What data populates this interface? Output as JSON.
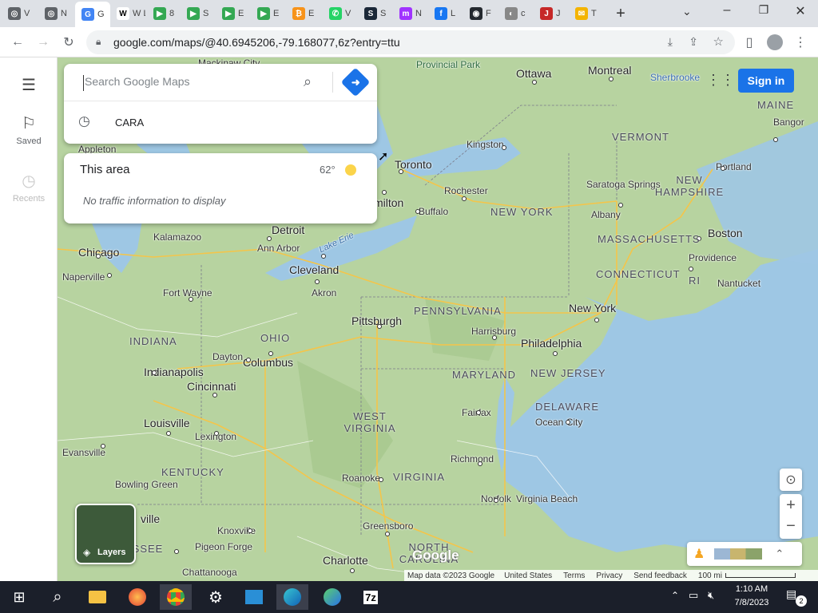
{
  "browser": {
    "tabs": [
      {
        "label": "V",
        "fav_color": "#5f6368",
        "fav_text": "◎"
      },
      {
        "label": "N",
        "fav_color": "#5f6368",
        "fav_text": "◎"
      },
      {
        "label": "G",
        "fav_color": "#4285f4",
        "fav_text": "G",
        "active": true
      },
      {
        "label": "W L",
        "fav_color": "#fff",
        "fav_text": "W"
      },
      {
        "label": "8",
        "fav_color": "#34a853",
        "fav_text": "▶"
      },
      {
        "label": "S",
        "fav_color": "#34a853",
        "fav_text": "▶"
      },
      {
        "label": "E",
        "fav_color": "#34a853",
        "fav_text": "▶"
      },
      {
        "label": "E",
        "fav_color": "#34a853",
        "fav_text": "▶"
      },
      {
        "label": "E",
        "fav_color": "#f7931a",
        "fav_text": "₿"
      },
      {
        "label": "V",
        "fav_color": "#25d366",
        "fav_text": "✆"
      },
      {
        "label": "S",
        "fav_color": "#1b2838",
        "fav_text": "S"
      },
      {
        "label": "N",
        "fav_color": "#a033ff",
        "fav_text": "m"
      },
      {
        "label": "L",
        "fav_color": "#1877f2",
        "fav_text": "f"
      },
      {
        "label": "F",
        "fav_color": "#24292f",
        "fav_text": "◉"
      },
      {
        "label": "c",
        "fav_color": "#888",
        "fav_text": "◐"
      },
      {
        "label": "J",
        "fav_color": "#c62828",
        "fav_text": "J"
      },
      {
        "label": "T",
        "fav_color": "#f4b400",
        "fav_text": "✉"
      }
    ],
    "new_tab_label": "+",
    "url": "google.com/maps/@40.6945206,-79.168077,6z?entry=ttu"
  },
  "maps": {
    "search": {
      "placeholder": "Search Google Maps"
    },
    "recent_item": "CARA",
    "rail": {
      "saved_label": "Saved",
      "recents_label": "Recents"
    },
    "area": {
      "title": "This area",
      "temperature": "62°",
      "traffic_text": "No traffic information to display"
    },
    "sign_in_label": "Sign in",
    "layers_label": "Layers",
    "google_logo": "Google",
    "footer": {
      "map_data": "Map data ©2023 Google",
      "country": "United States",
      "terms": "Terms",
      "privacy": "Privacy",
      "feedback": "Send feedback",
      "scale": "100 mi"
    },
    "cities": [
      {
        "name": "Ottawa",
        "cls": "biglabel"
      },
      {
        "name": "Montreal",
        "cls": "biglabel"
      },
      {
        "name": "Sherbrooke",
        "cls": "maplabel"
      },
      {
        "name": "Kingston",
        "cls": "maplabel"
      },
      {
        "name": "Toronto",
        "cls": "biglabel"
      },
      {
        "name": "Rochester",
        "cls": "maplabel"
      },
      {
        "name": "Buffalo",
        "cls": "maplabel"
      },
      {
        "name": "milton",
        "cls": "biglabel"
      },
      {
        "name": "Saratoga Springs",
        "cls": "maplabel"
      },
      {
        "name": "Albany",
        "cls": "maplabel"
      },
      {
        "name": "Portland",
        "cls": "maplabel"
      },
      {
        "name": "Bangor",
        "cls": "maplabel"
      },
      {
        "name": "Boston",
        "cls": "biglabel"
      },
      {
        "name": "Providence",
        "cls": "maplabel"
      },
      {
        "name": "Nantucket",
        "cls": "maplabel"
      },
      {
        "name": "New York",
        "cls": "biglabel"
      },
      {
        "name": "Philadelphia",
        "cls": "biglabel"
      },
      {
        "name": "Harrisburg",
        "cls": "maplabel"
      },
      {
        "name": "Pittsburgh",
        "cls": "biglabel"
      },
      {
        "name": "Cleveland",
        "cls": "biglabel"
      },
      {
        "name": "Akron",
        "cls": "maplabel"
      },
      {
        "name": "Detroit",
        "cls": "biglabel"
      },
      {
        "name": "Ann Arbor",
        "cls": "maplabel"
      },
      {
        "name": "Kalamazoo",
        "cls": "maplabel"
      },
      {
        "name": "Chicago",
        "cls": "biglabel"
      },
      {
        "name": "Naperville",
        "cls": "maplabel"
      },
      {
        "name": "Fort Wayne",
        "cls": "maplabel"
      },
      {
        "name": "Columbus",
        "cls": "biglabel"
      },
      {
        "name": "Dayton",
        "cls": "maplabel"
      },
      {
        "name": "Indianapolis",
        "cls": "biglabel"
      },
      {
        "name": "Cincinnati",
        "cls": "biglabel"
      },
      {
        "name": "Louisville",
        "cls": "biglabel"
      },
      {
        "name": "Lexington",
        "cls": "maplabel"
      },
      {
        "name": "Evansville",
        "cls": "maplabel"
      },
      {
        "name": "Bowling Green",
        "cls": "maplabel"
      },
      {
        "name": "Fairfax",
        "cls": "maplabel"
      },
      {
        "name": "Ocean City",
        "cls": "maplabel"
      },
      {
        "name": "Richmond",
        "cls": "maplabel"
      },
      {
        "name": "Roanoke",
        "cls": "maplabel"
      },
      {
        "name": "Norfolk",
        "cls": "maplabel"
      },
      {
        "name": "Virginia Beach",
        "cls": "maplabel"
      },
      {
        "name": "Greensboro",
        "cls": "maplabel"
      },
      {
        "name": "Knoxville",
        "cls": "maplabel"
      },
      {
        "name": "Pigeon Forge",
        "cls": "maplabel"
      },
      {
        "name": "Chattanooga",
        "cls": "maplabel"
      },
      {
        "name": "Charlotte",
        "cls": "biglabel"
      },
      {
        "name": "Appleton",
        "cls": "maplabel"
      },
      {
        "name": "Mackinaw City",
        "cls": "maplabel"
      },
      {
        "name": "Provincial Park",
        "cls": "maplabel"
      },
      {
        "name": "Lake Erie",
        "cls": "maplabel"
      },
      {
        "name": "ville",
        "cls": "biglabel"
      }
    ],
    "states": [
      "MAINE",
      "VERMONT",
      "NEW HAMPSHIRE",
      "MASSACHUSETTS",
      "CONNECTICUT",
      "RI",
      "NEW YORK",
      "PENNSYLVANIA",
      "NEW JERSEY",
      "MARYLAND",
      "DELAWARE",
      "OHIO",
      "INDIANA",
      "WEST VIRGINIA",
      "VIRGINIA",
      "KENTUCKY",
      "NORTH CAROLINA",
      "ESSEE"
    ]
  },
  "taskbar": {
    "time": "1:10 AM",
    "date": "7/8/2023",
    "notif_count": "2"
  }
}
